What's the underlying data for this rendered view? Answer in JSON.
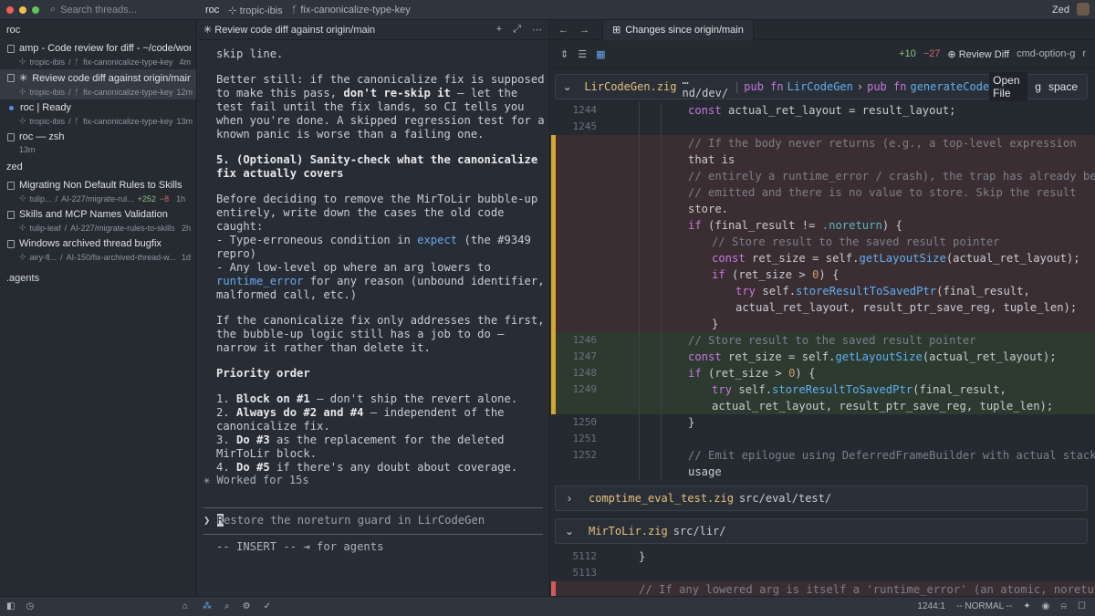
{
  "titlebar": {
    "search_placeholder": "Search threads...",
    "project": "roc",
    "worktree": "tropic-ibis",
    "branch": "fix-canonicalize-type-key",
    "user": "Zed"
  },
  "sidebar": {
    "group_roc": "roc",
    "threads_roc": [
      {
        "title": "amp - Code review for diff - ~/code/worktr",
        "worktree": "tropic-ibis",
        "branch": "fix-canonicalize-type-key",
        "time": "4m"
      },
      {
        "title": "Review code diff against origin/main",
        "worktree": "tropic-ibis",
        "branch": "fix-canonicalize-type-key",
        "time": "12m"
      },
      {
        "title": "roc | Ready",
        "worktree": "tropic-ibis",
        "branch": "fix-canonicalize-type-key",
        "time": "13m"
      },
      {
        "title": "roc — zsh",
        "time": "13m"
      }
    ],
    "group_zed": "zed",
    "threads_zed": [
      {
        "title": "Migrating Non Default Rules to Skills",
        "worktree": "tulip...",
        "branch": "AI-227/migrate-rul...",
        "added": "+252",
        "removed": "−8",
        "time": "1h"
      },
      {
        "title": "Skills and MCP Names Validation",
        "worktree": "tulip-leaf",
        "branch": "AI-227/migrate-rules-to-skills",
        "time": "2h"
      },
      {
        "title": "Windows archived thread bugfix",
        "worktree": "airy-fl...",
        "branch": "AI-150/fix-archived-thread-w...",
        "time": "1d"
      }
    ],
    "group_agents": ".agents"
  },
  "agent": {
    "tab_title": "Review code diff against origin/main",
    "p1": "skip line.",
    "p2_a": "Better still: if the canonicalize fix is supposed to make this pass, ",
    "p2_b": "don't re-skip it",
    "p2_c": " — let the test fail until the fix lands, so CI tells you when you're done. A skipped regression test for a known panic is worse than a failing one.",
    "p3": "5. (Optional) Sanity-check what the canonicalize fix actually covers",
    "p4_a": "Before deciding to remove the MirToLir bubble-up entirely, write down the cases the old code caught:\n- Type-erroneous condition in ",
    "p4_b": "expect",
    "p4_c": " (the #9349 repro)\n- Any low-level op where an arg lowers to ",
    "p4_d": "runtime_error",
    "p4_e": " for any reason (unbound identifier, malformed call, etc.)",
    "p5": "If the canonicalize fix only addresses the first, the bubble-up logic still has a job to do — narrow it rather than delete it.",
    "p6": "Priority order",
    "l1_b": "Block on #1",
    "l1_t": " — don't ship the revert alone.",
    "l2_b": "Always do #2 and #4",
    "l2_t": " — independent of the canonicalize fix.",
    "l3_b": "Do #3",
    "l3_t": " as the replacement for the deleted MirToLir block.",
    "l4_b": "Do #5",
    "l4_t": " if there's any doubt about coverage.",
    "l1_n": "1. ",
    "l2_n": "2. ",
    "l3_n": "3. ",
    "l4_n": "4. ",
    "worked": "Worked for 15s",
    "prompt_first": "R",
    "prompt_rest": "estore the noreturn guard in LirCodeGen",
    "mode": "-- INSERT -- ⇥ for agents"
  },
  "diff": {
    "tab_title": "Changes since origin/main",
    "added": "+10",
    "removed": "−27",
    "review_label": "Review Diff",
    "shortcut": "cmd-option-g",
    "shortcut_extra": "r",
    "file1": {
      "name": "LirCodeGen.zig",
      "dir": "…nd/dev/",
      "kw1": "pub fn",
      "sym1": "LirCodeGen",
      "kw2": "pub fn",
      "sym2": "generateCode",
      "open": "Open File",
      "key1": "g",
      "key2": "space"
    },
    "file2": {
      "name": "comptime_eval_test.zig",
      "dir": "src/eval/test/"
    },
    "file3": {
      "name": "MirToLir.zig",
      "dir": "src/lir/"
    },
    "lines": [
      {
        "n": "1244",
        "text": "const actual_ret_layout = result_layout;"
      },
      {
        "n": "1245",
        "text": ""
      },
      {
        "n": "",
        "text": "// If the body never returns (e.g., a top-level expression"
      },
      {
        "n": "",
        "text": "that is"
      },
      {
        "n": "",
        "text": "// entirely a runtime_error / crash), the trap has already been"
      },
      {
        "n": "",
        "text": "// emitted and there is no value to store. Skip the result"
      },
      {
        "n": "",
        "text": "store."
      },
      {
        "n": "",
        "text": "if (final_result != .noreturn) {"
      },
      {
        "n": "",
        "text": "// Store result to the saved result pointer"
      },
      {
        "n": "",
        "text": "const ret_size = self.getLayoutSize(actual_ret_layout);"
      },
      {
        "n": "",
        "text": "if (ret_size > 0) {"
      },
      {
        "n": "",
        "text": "try self.storeResultToSavedPtr(final_result,"
      },
      {
        "n": "",
        "text": "actual_ret_layout, result_ptr_save_reg, tuple_len);"
      },
      {
        "n": "",
        "text": "}"
      },
      {
        "n": "1246",
        "text": "// Store result to the saved result pointer"
      },
      {
        "n": "1247",
        "text": "const ret_size = self.getLayoutSize(actual_ret_layout);"
      },
      {
        "n": "1248",
        "text": "if (ret_size > 0) {"
      },
      {
        "n": "1249",
        "text": "try self.storeResultToSavedPtr(final_result,"
      },
      {
        "n": "",
        "text": "actual_ret_layout, result_ptr_save_reg, tuple_len);"
      },
      {
        "n": "1250",
        "text": "}"
      },
      {
        "n": "1251",
        "text": ""
      },
      {
        "n": "1252",
        "text": "// Emit epilogue using DeferredFrameBuilder with actual stack"
      },
      {
        "n": "",
        "text": "usage"
      }
    ],
    "mir_lines": [
      {
        "n": "5112",
        "text": "}"
      },
      {
        "n": "5113",
        "text": ""
      },
      {
        "n": "",
        "text": "// If any lowered arg is itself a 'runtime_error' (an atomic, noreturn"
      }
    ]
  },
  "statusbar": {
    "cursor": "1244:1",
    "mode": "-- NORMAL --"
  },
  "colors": {
    "accent_yellow": "#d4a82c",
    "del_bar": "#d45a5a",
    "add_green": "#8ec27e"
  }
}
